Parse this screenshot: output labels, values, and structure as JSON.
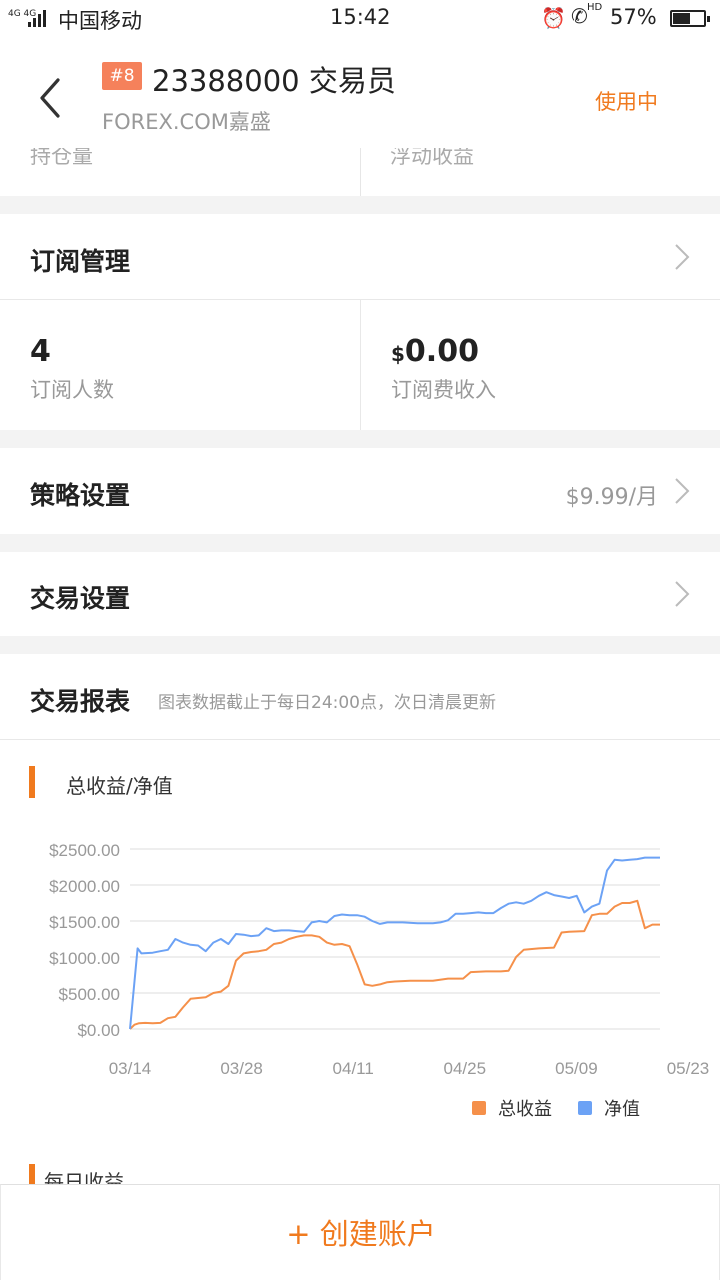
{
  "status_bar": {
    "network": "4G 4G",
    "carrier": "中国移动",
    "time": "15:42",
    "hd": "HD",
    "battery": "57%",
    "battery_level": 0.57
  },
  "header": {
    "badge": "#8",
    "title": "23388000 交易员",
    "subtitle": "FOREX.COM嘉盛",
    "status": "使用中"
  },
  "overview": {
    "left_label": "持仓量",
    "right_label": "浮动收益"
  },
  "subscription": {
    "label": "订阅管理",
    "count": "4",
    "count_label": "订阅人数",
    "income_currency": "$",
    "income_value": "0.00",
    "income_label": "订阅费收入"
  },
  "strategy": {
    "label": "策略设置",
    "value": "$9.99/月"
  },
  "trade_settings": {
    "label": "交易设置"
  },
  "report": {
    "title": "交易报表",
    "note": "图表数据截止于每日24:00点，次日清晨更新",
    "next_section": "每日收益"
  },
  "colors": {
    "accent": "#f07a1e",
    "series_total": "#f5904a",
    "series_equity": "#6ca2f5"
  },
  "chart_data": {
    "type": "line",
    "title": "总收益/净值",
    "y_ticks": [
      "$2500.00",
      "$2000.00",
      "$1500.00",
      "$1000.00",
      "$500.00",
      "$0.00"
    ],
    "x_ticks": [
      "03/14",
      "03/28",
      "04/11",
      "04/25",
      "05/09",
      "05/23"
    ],
    "ylim": [
      0,
      2500
    ],
    "x_range_days": [
      0,
      70
    ],
    "legend_position": "bottom-right",
    "grid": true,
    "series": [
      {
        "name": "总收益",
        "color": "#f5904a",
        "points": [
          [
            0,
            0
          ],
          [
            0.6,
            60
          ],
          [
            1.2,
            80
          ],
          [
            2,
            85
          ],
          [
            3,
            80
          ],
          [
            4,
            85
          ],
          [
            5,
            150
          ],
          [
            6,
            170
          ],
          [
            7,
            300
          ],
          [
            8,
            420
          ],
          [
            9,
            430
          ],
          [
            10,
            440
          ],
          [
            11,
            500
          ],
          [
            12,
            520
          ],
          [
            13,
            600
          ],
          [
            14,
            950
          ],
          [
            15,
            1050
          ],
          [
            16,
            1070
          ],
          [
            17,
            1080
          ],
          [
            18,
            1100
          ],
          [
            19,
            1180
          ],
          [
            20,
            1200
          ],
          [
            21,
            1250
          ],
          [
            22,
            1280
          ],
          [
            23,
            1300
          ],
          [
            24,
            1300
          ],
          [
            25,
            1280
          ],
          [
            26,
            1200
          ],
          [
            27,
            1170
          ],
          [
            28,
            1180
          ],
          [
            29,
            1150
          ],
          [
            30,
            900
          ],
          [
            31,
            620
          ],
          [
            32,
            600
          ],
          [
            33,
            620
          ],
          [
            34,
            650
          ],
          [
            35,
            660
          ],
          [
            37,
            670
          ],
          [
            40,
            670
          ],
          [
            42,
            700
          ],
          [
            44,
            700
          ],
          [
            45,
            790
          ],
          [
            47,
            800
          ],
          [
            49,
            800
          ],
          [
            50,
            810
          ],
          [
            51,
            1000
          ],
          [
            52,
            1100
          ],
          [
            54,
            1120
          ],
          [
            56,
            1130
          ],
          [
            57,
            1340
          ],
          [
            58,
            1350
          ],
          [
            60,
            1360
          ],
          [
            61,
            1580
          ],
          [
            62,
            1600
          ],
          [
            63,
            1600
          ],
          [
            64,
            1700
          ],
          [
            65,
            1750
          ],
          [
            66,
            1750
          ],
          [
            67,
            1780
          ],
          [
            68,
            1400
          ],
          [
            69,
            1450
          ],
          [
            70,
            1450
          ]
        ]
      },
      {
        "name": "净值",
        "color": "#6ca2f5",
        "points": [
          [
            0,
            0
          ],
          [
            1,
            1120
          ],
          [
            1.5,
            1050
          ],
          [
            3,
            1060
          ],
          [
            4,
            1080
          ],
          [
            5,
            1100
          ],
          [
            6,
            1250
          ],
          [
            7,
            1200
          ],
          [
            8,
            1170
          ],
          [
            9,
            1160
          ],
          [
            10,
            1080
          ],
          [
            11,
            1200
          ],
          [
            12,
            1250
          ],
          [
            13,
            1180
          ],
          [
            14,
            1320
          ],
          [
            15,
            1310
          ],
          [
            16,
            1290
          ],
          [
            17,
            1300
          ],
          [
            18,
            1400
          ],
          [
            19,
            1360
          ],
          [
            20,
            1370
          ],
          [
            21,
            1370
          ],
          [
            22,
            1360
          ],
          [
            23,
            1350
          ],
          [
            24,
            1480
          ],
          [
            25,
            1500
          ],
          [
            26,
            1480
          ],
          [
            27,
            1570
          ],
          [
            28,
            1590
          ],
          [
            29,
            1580
          ],
          [
            30,
            1580
          ],
          [
            31,
            1560
          ],
          [
            32,
            1500
          ],
          [
            33,
            1460
          ],
          [
            34,
            1480
          ],
          [
            36,
            1480
          ],
          [
            38,
            1470
          ],
          [
            40,
            1470
          ],
          [
            41,
            1480
          ],
          [
            42,
            1510
          ],
          [
            43,
            1600
          ],
          [
            44,
            1600
          ],
          [
            45,
            1610
          ],
          [
            46,
            1620
          ],
          [
            47,
            1610
          ],
          [
            48,
            1610
          ],
          [
            49,
            1680
          ],
          [
            50,
            1740
          ],
          [
            51,
            1760
          ],
          [
            52,
            1740
          ],
          [
            53,
            1780
          ],
          [
            54,
            1850
          ],
          [
            55,
            1900
          ],
          [
            56,
            1860
          ],
          [
            57,
            1840
          ],
          [
            58,
            1820
          ],
          [
            59,
            1850
          ],
          [
            60,
            1620
          ],
          [
            61,
            1700
          ],
          [
            62,
            1740
          ],
          [
            63,
            2200
          ],
          [
            64,
            2350
          ],
          [
            65,
            2340
          ],
          [
            66,
            2350
          ],
          [
            67,
            2360
          ],
          [
            68,
            2380
          ],
          [
            70,
            2380
          ]
        ]
      }
    ]
  }
}
